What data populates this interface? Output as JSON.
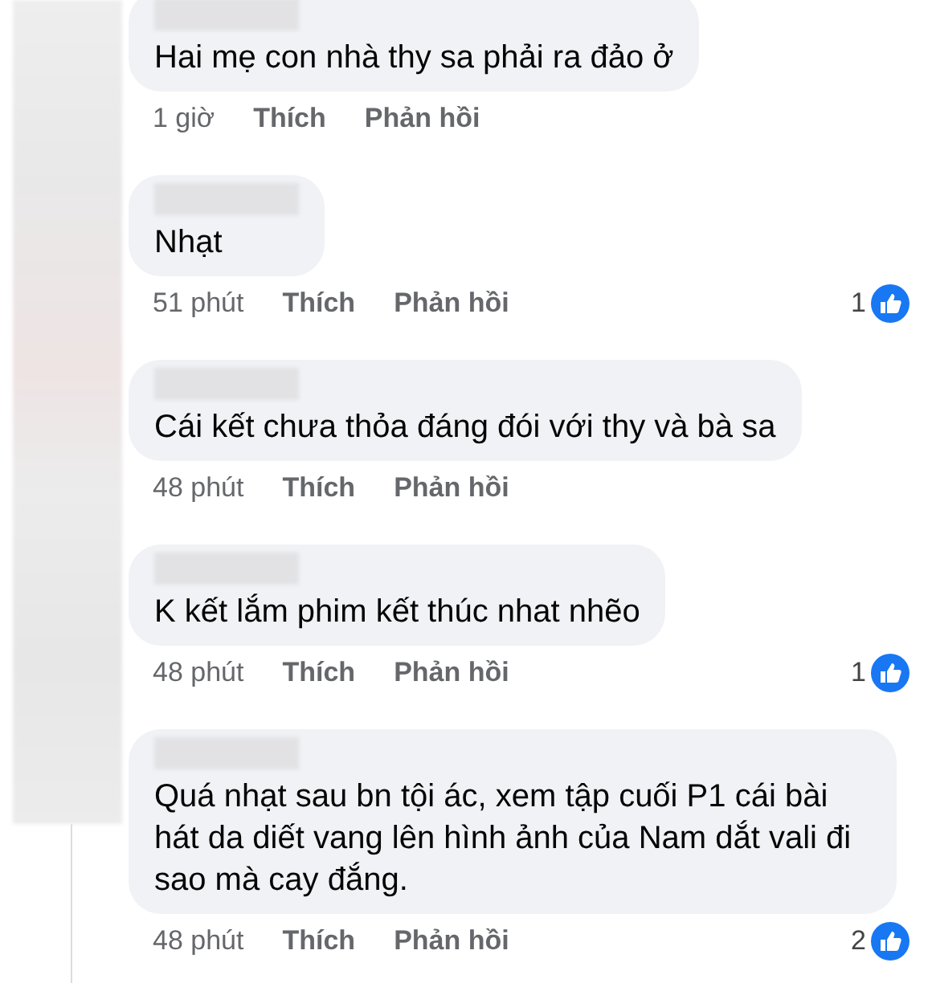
{
  "comments": [
    {
      "text": "Hai mẹ con nhà thy sa phải ra đảo ở",
      "time": "1 giờ",
      "like": "Thích",
      "reply": "Phản hồi"
    },
    {
      "text": "Nhạt",
      "time": "51 phút",
      "like": "Thích",
      "reply": "Phản hồi",
      "reactions": "1"
    },
    {
      "text": "Cái kết chưa thỏa đáng đói với thy và bà sa",
      "time": "48 phút",
      "like": "Thích",
      "reply": "Phản hồi"
    },
    {
      "text": "K kết lắm phim kết thúc nhat nhẽo",
      "time": "48 phút",
      "like": "Thích",
      "reply": "Phản hồi",
      "reactions": "1"
    },
    {
      "text": "Quá nhạt sau bn tội ác, xem tập cuối P1 cái bài hát da diết vang lên hình ảnh của Nam dắt vali đi sao mà cay đắng.",
      "time": "48 phút",
      "like": "Thích",
      "reply": "Phản hồi",
      "reactions": "2"
    }
  ]
}
